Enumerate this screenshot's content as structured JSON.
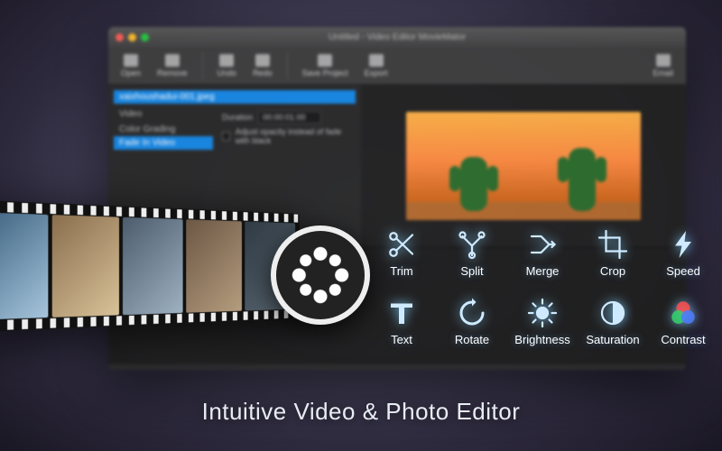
{
  "window": {
    "title": "Untitled - Video Editor MovieMator"
  },
  "toolbar": {
    "open": "Open",
    "remove": "Remove",
    "undo": "Undo",
    "redo": "Redo",
    "save": "Save Project",
    "export": "Export",
    "email": "Email"
  },
  "panel": {
    "filename": "xaixhoushadui-001.jpeg",
    "section": "Video",
    "item_color": "Color Grading",
    "item_fade": "Fade In Video",
    "duration_label": "Duration",
    "duration_value": "00:00:01:00",
    "opacity_label": "Adjust opacity instead of fade with black"
  },
  "features": [
    {
      "key": "trim",
      "label": "Trim"
    },
    {
      "key": "split",
      "label": "Split"
    },
    {
      "key": "merge",
      "label": "Merge"
    },
    {
      "key": "crop",
      "label": "Crop"
    },
    {
      "key": "speed",
      "label": "Speed"
    },
    {
      "key": "text",
      "label": "Text"
    },
    {
      "key": "rotate",
      "label": "Rotate"
    },
    {
      "key": "brightness",
      "label": "Brightness"
    },
    {
      "key": "saturation",
      "label": "Saturation"
    },
    {
      "key": "contrast",
      "label": "Contrast"
    }
  ],
  "tagline": "Intuitive Video & Photo Editor"
}
